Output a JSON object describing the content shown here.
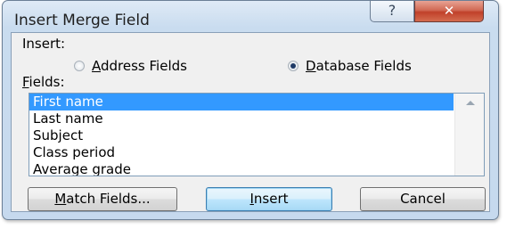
{
  "dialog": {
    "title": "Insert Merge Field",
    "help_label": "?",
    "close_label": "✕"
  },
  "insert_group": {
    "label": "Insert:",
    "options": [
      {
        "label_mnemonic": "A",
        "label_rest": "ddress Fields",
        "selected": false
      },
      {
        "label_mnemonic": "D",
        "label_rest": "atabase Fields",
        "selected": true
      }
    ]
  },
  "fields": {
    "label_mnemonic": "F",
    "label_rest": "ields:",
    "items": [
      "First name",
      "Last name",
      "Subject",
      "Class period",
      "Average grade"
    ],
    "selected_index": 0
  },
  "buttons": {
    "match_mnemonic": "M",
    "match_rest": "atch Fields...",
    "insert_mnemonic": "I",
    "insert_rest": "nsert",
    "cancel": "Cancel"
  }
}
